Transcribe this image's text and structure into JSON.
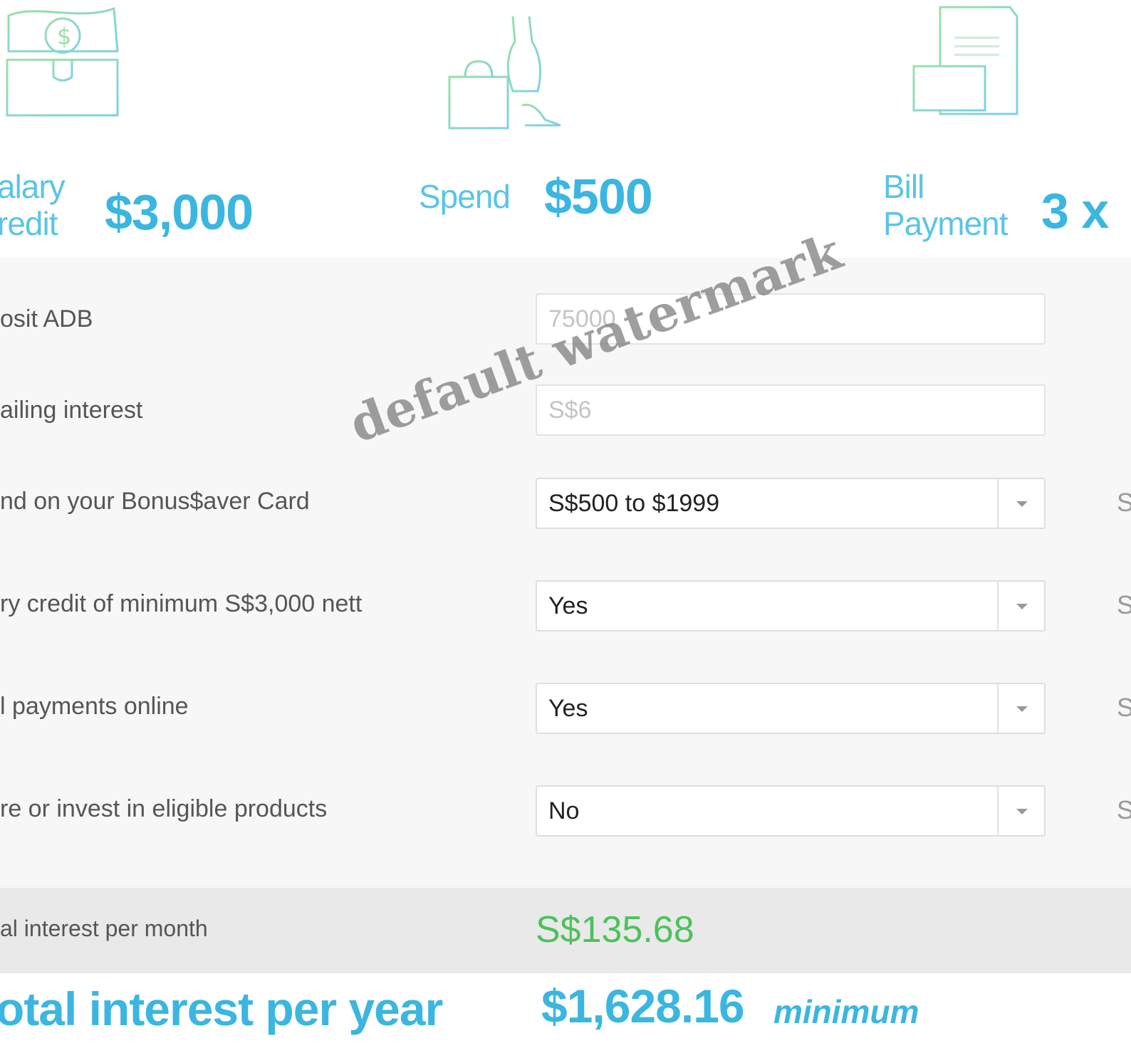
{
  "categories": [
    {
      "label": "alary",
      "label2": "redit",
      "value": "$3,000",
      "icon": "money-wallet-icon"
    },
    {
      "label": "Spend",
      "value": "$500",
      "icon": "shopping-dress-icon"
    },
    {
      "label": "Bill",
      "label2": "Payment",
      "value": "3 x",
      "icon": "bill-documents-icon"
    }
  ],
  "form": {
    "rows": [
      {
        "label": "osit ADB",
        "control": "input",
        "placeholder": "75000"
      },
      {
        "label": "ailing interest",
        "control": "input",
        "placeholder": "S$6"
      },
      {
        "label": "nd on your Bonus$aver Card",
        "control": "select",
        "value": "S$500 to $1999",
        "edge": "S"
      },
      {
        "label": "ry credit of minimum S$3,000 nett",
        "control": "select",
        "value": "Yes",
        "edge": "S"
      },
      {
        "label": "l payments online",
        "control": "select",
        "value": "Yes",
        "edge": "S"
      },
      {
        "label": "re or invest in eligible products",
        "control": "select",
        "value": "No",
        "edge": "S"
      }
    ]
  },
  "summary": {
    "month_label": "al interest per month",
    "month_value": "S$135.68",
    "year_label": "otal interest per year",
    "year_value": "$1,628.16",
    "year_suffix": "minimum"
  },
  "watermark": "default watermark",
  "colors": {
    "accent_blue": "#3bb6e0",
    "label_blue": "#5bc4e6",
    "green": "#4cc25b",
    "icon_green": "#8fd9a8"
  }
}
